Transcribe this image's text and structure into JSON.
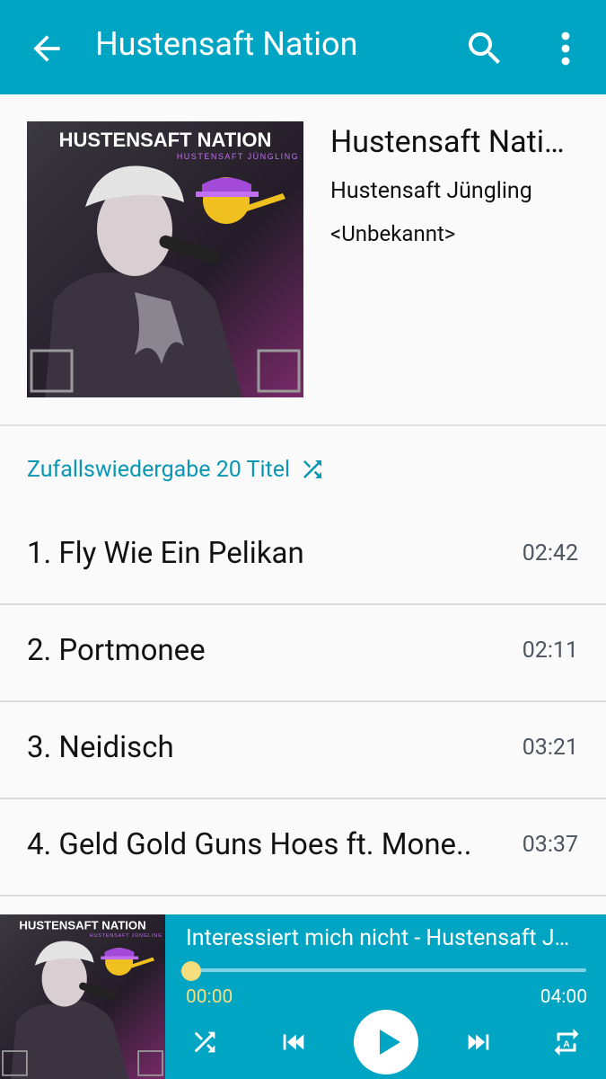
{
  "appbar": {
    "title": "Hustensaft Nation",
    "back_icon": "arrow-back-icon",
    "search_icon": "search-icon",
    "more_icon": "more-vert-icon"
  },
  "album": {
    "title": "Hustensaft Nati…",
    "artist": "Hustensaft Jüngling",
    "year": "<Unbekannt>",
    "cover_text_main": "HUSTENSAFT NATION",
    "cover_text_sub": "HUSTENSAFT JÜNGLING"
  },
  "shuffle": {
    "label": "Zufallswiedergabe 20 Titel",
    "icon": "shuffle-icon"
  },
  "tracks": [
    {
      "title": "1. Fly Wie Ein Pelikan",
      "duration": "02:42"
    },
    {
      "title": "2. Portmonee",
      "duration": "02:11"
    },
    {
      "title": "3. Neidisch",
      "duration": "03:21"
    },
    {
      "title": "4. Geld Gold Guns Hoes ft. Mone..",
      "duration": "03:37"
    }
  ],
  "player": {
    "now_playing": "Interessiert mich nicht - Hustensaft J…",
    "elapsed": "00:00",
    "total": "04:00",
    "progress": 0.0,
    "controls": [
      "shuffle-icon",
      "skip-previous-icon",
      "play-icon",
      "skip-next-icon",
      "repeat-icon"
    ]
  },
  "colors": {
    "accent": "#00a5c4",
    "accent_text": "#0a97b3",
    "seek_thumb": "#f6dd7e"
  }
}
